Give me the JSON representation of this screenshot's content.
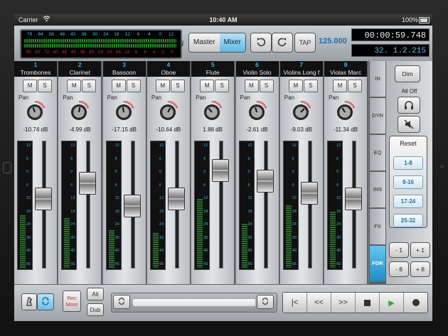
{
  "status": {
    "carrier": "Carrier",
    "time": "10:40 AM",
    "battery": "100%"
  },
  "meter": {
    "top_scale": [
      "78",
      "64",
      "58",
      "48",
      "42",
      "36",
      "30",
      "24",
      "18",
      "12",
      "6",
      "4",
      "0",
      "12"
    ],
    "bottom_scale": [
      "90",
      "60",
      "72",
      "60",
      "48",
      "42",
      "36",
      "30",
      "24",
      "20",
      "16",
      "12",
      "8",
      "6",
      "4",
      "2",
      "0"
    ]
  },
  "toolbar": {
    "master_label": "Master",
    "mixer_label": "Mixer",
    "tap_label": "TAP",
    "tempo": "125.000",
    "time_display": "00:00:59.748",
    "bar_display": "32. 1.2.215"
  },
  "channels": [
    {
      "num": "1",
      "name": "Trombones",
      "db": "-10.74 dB",
      "level": 0.42,
      "fader": 0.55
    },
    {
      "num": "2",
      "name": "Clarinet",
      "db": "-4.99 dB",
      "level": 0.4,
      "fader": 0.7
    },
    {
      "num": "3",
      "name": "Bassoon",
      "db": "-17.15 dB",
      "level": 0.3,
      "fader": 0.48
    },
    {
      "num": "4",
      "name": "Oboe",
      "db": "-10.64 dB",
      "level": 0.28,
      "fader": 0.55
    },
    {
      "num": "5",
      "name": "Flute",
      "db": "1.88 dB",
      "level": 0.55,
      "fader": 0.82
    },
    {
      "num": "6",
      "name": "Violin Solo",
      "db": "-2.61 dB",
      "level": 0.35,
      "fader": 0.72
    },
    {
      "num": "7",
      "name": "Violins Long f",
      "db": "-9.03 dB",
      "level": 0.5,
      "fader": 0.6
    },
    {
      "num": "8",
      "name": "Violas Marc",
      "db": "-11.34 dB",
      "level": 0.45,
      "fader": 0.55
    }
  ],
  "strip_labels": {
    "mute": "M",
    "solo": "S",
    "pan": "Pan"
  },
  "meter_scale": [
    "12",
    "6",
    "0",
    "6",
    "12",
    "18",
    "24",
    "30",
    "40",
    "56"
  ],
  "tabs": [
    {
      "label": "IN",
      "active": false
    },
    {
      "label": "DYN",
      "active": false
    },
    {
      "label": "EQ",
      "active": false
    },
    {
      "label": "INS",
      "active": false
    },
    {
      "label": "FX",
      "active": false
    },
    {
      "label": "FDR",
      "active": true
    }
  ],
  "right_panel": {
    "dim_label": "Dim",
    "all_off_label": "All Off",
    "reset_label": "Reset",
    "groups": [
      "1-8",
      "9-16",
      "17-24",
      "25-32"
    ],
    "step_minus1": "- 1",
    "step_plus1": "+ 1",
    "step_minus8": "- 8",
    "step_plus8": "+ 8"
  },
  "bottom": {
    "rec_more_label": "Rec\nMore",
    "alt_label": "Alt",
    "dub_label": "Dub"
  },
  "icons": {
    "metronome": "metronome-icon",
    "loop": "loop-icon",
    "undo": "undo-icon",
    "redo": "redo-icon",
    "headphones": "headphones-icon",
    "speaker_mute": "speaker-mute-icon"
  },
  "colors": {
    "accent": "#36b3ea",
    "active_tab": "#1f8dc7",
    "meter_red": "#e22233",
    "knob_red": "#d9221c"
  }
}
